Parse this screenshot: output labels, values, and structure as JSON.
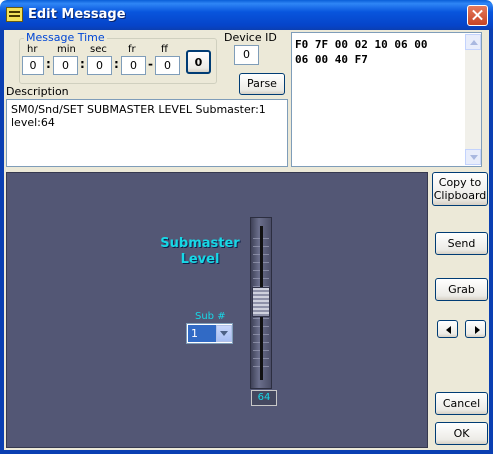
{
  "window": {
    "title": "Edit Message"
  },
  "message_time": {
    "group_label": "Message Time",
    "labels": {
      "hr": "hr",
      "min": "min",
      "sec": "sec",
      "fr": "fr",
      "ff": "ff"
    },
    "values": {
      "hr": "0",
      "min": "0",
      "sec": "0",
      "fr": "0",
      "ff": "0"
    },
    "separator_colon": ":",
    "separator_dash": "-",
    "zero_button": "0"
  },
  "device": {
    "label": "Device ID",
    "value": "0"
  },
  "parse_button": "Parse",
  "description": {
    "label": "Description",
    "text": "SM0/Snd/SET SUBMASTER LEVEL Submaster:1 level:64"
  },
  "hex": {
    "line1": "F0 7F 00 02 10 06 00",
    "line2": "06 00 40 F7"
  },
  "panel": {
    "title_line1": "Submaster",
    "title_line2": "Level",
    "sub_label": "Sub #",
    "sub_value": "1",
    "level_value": "64",
    "fader_level_fraction": 0.5
  },
  "buttons": {
    "copy_line1": "Copy to",
    "copy_line2": "Clipboard",
    "send": "Send",
    "grab": "Grab",
    "prev": "<",
    "next": ">",
    "cancel": "Cancel",
    "ok": "OK"
  },
  "colors": {
    "panel_bg": "#535775",
    "accent_cyan": "#17d8e6",
    "title_bar": "#0a55dd"
  }
}
